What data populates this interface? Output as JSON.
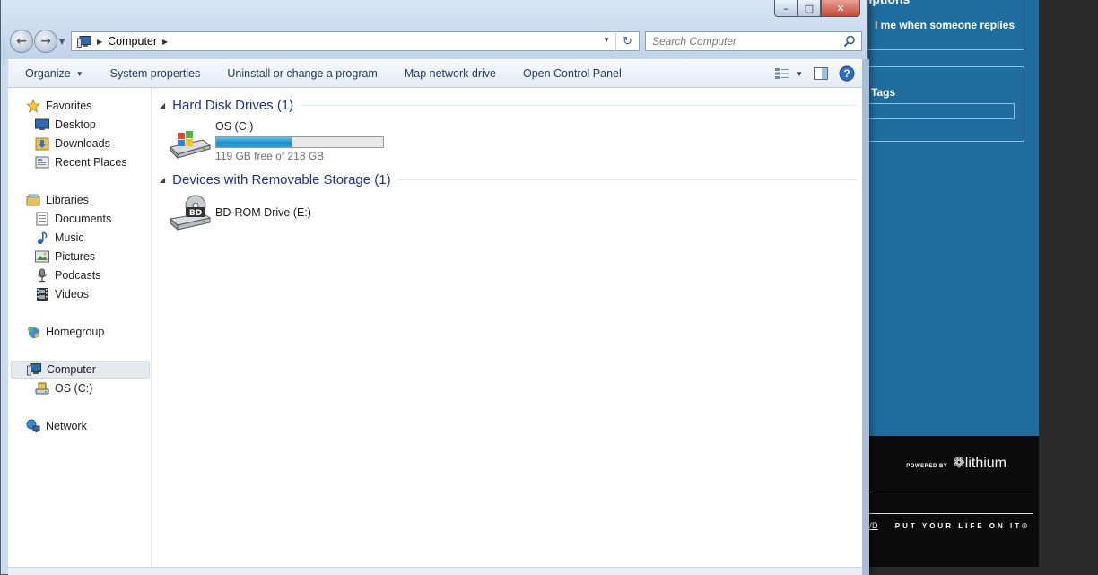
{
  "background_page": {
    "panel1_title": "riptions",
    "panel1_text": "l me when someone replies",
    "panel2_text": "e Tags",
    "powered_by": "POWERED BY",
    "brand": "lithium",
    "wd_text": "VD",
    "tagline": "PUT YOUR LIFE ON IT®"
  },
  "window": {
    "caption_buttons": {
      "minimize": "–",
      "maximize": "□",
      "close": "✕"
    }
  },
  "address_bar": {
    "crumbs": [
      "Computer"
    ],
    "icon": "computer-icon"
  },
  "search": {
    "placeholder": "Search Computer"
  },
  "toolbar": {
    "organize": "Organize",
    "system_properties": "System properties",
    "uninstall": "Uninstall or change a program",
    "map_drive": "Map network drive",
    "control_panel": "Open Control Panel"
  },
  "nav_pane": {
    "favorites": "Favorites",
    "desktop": "Desktop",
    "downloads": "Downloads",
    "recent": "Recent Places",
    "libraries": "Libraries",
    "documents": "Documents",
    "music": "Music",
    "pictures": "Pictures",
    "podcasts": "Podcasts",
    "videos": "Videos",
    "homegroup": "Homegroup",
    "computer": "Computer",
    "os_c": "OS (C:)",
    "network": "Network"
  },
  "main": {
    "hdd_group": "Hard Disk Drives (1)",
    "removable_group": "Devices with Removable Storage (1)",
    "drive_c": {
      "name": "OS (C:)",
      "free_text": "119 GB free of 218 GB",
      "used_fraction": 0.454
    },
    "drive_e": {
      "name": "BD-ROM Drive (E:)",
      "badge": "BD"
    }
  },
  "colors": {
    "accent_blue": "#1e3287",
    "page_blue": "#1f6d9f",
    "bar_fill": "#26a1d8"
  }
}
